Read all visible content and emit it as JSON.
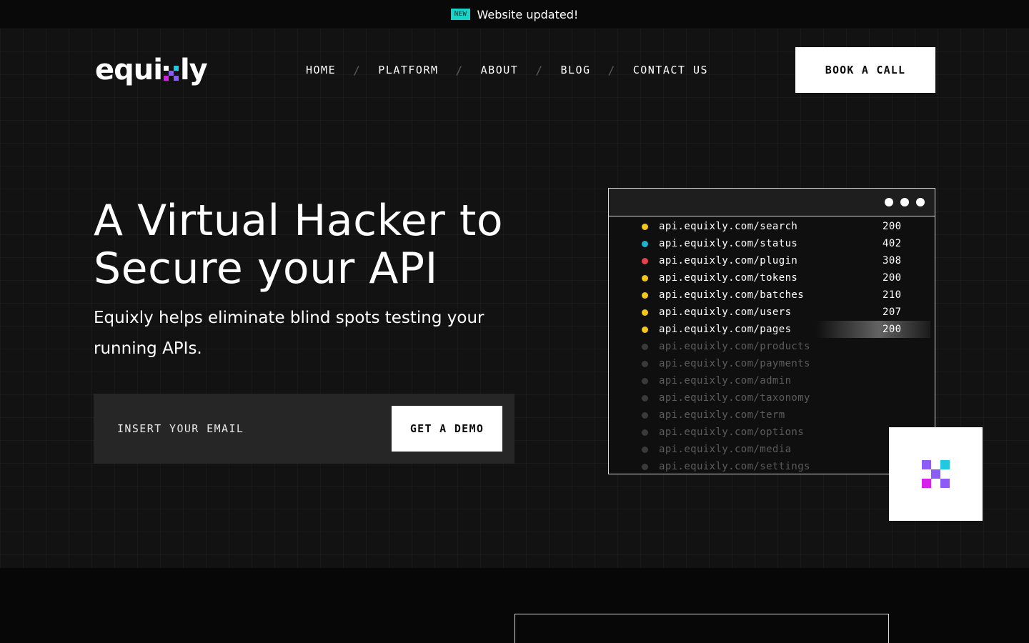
{
  "announcement": {
    "badge": "NEW",
    "message": "Website updated!"
  },
  "header": {
    "logo_text_left": "equi",
    "logo_text_right": "ly",
    "nav": [
      {
        "label": "HOME"
      },
      {
        "label": "PLATFORM"
      },
      {
        "label": "ABOUT"
      },
      {
        "label": "BLOG"
      },
      {
        "label": "CONTACT US"
      }
    ],
    "nav_separator": "/",
    "cta_label": "BOOK A CALL"
  },
  "hero": {
    "headline_line1": "A Virtual Hacker to",
    "headline_line2": "Secure your API",
    "subline": "Equixly helps eliminate blind spots testing your running APIs.",
    "email_placeholder": "INSERT YOUR EMAIL",
    "demo_button": "GET A DEMO"
  },
  "terminal": {
    "rows": [
      {
        "url": "api.equixly.com/search",
        "code": "200",
        "status_color": "#f5c518",
        "state": "active"
      },
      {
        "url": "api.equixly.com/status",
        "code": "402",
        "status_color": "#1fb3c9",
        "state": "active"
      },
      {
        "url": "api.equixly.com/plugin",
        "code": "308",
        "status_color": "#e8414b",
        "state": "active"
      },
      {
        "url": "api.equixly.com/tokens",
        "code": "200",
        "status_color": "#f5c518",
        "state": "active"
      },
      {
        "url": "api.equixly.com/batches",
        "code": "210",
        "status_color": "#f5c518",
        "state": "active"
      },
      {
        "url": "api.equixly.com/users",
        "code": "207",
        "status_color": "#f5c518",
        "state": "active"
      },
      {
        "url": "api.equixly.com/pages",
        "code": "200",
        "status_color": "#f5c518",
        "state": "scanning"
      },
      {
        "url": "api.equixly.com/products",
        "code": "",
        "status_color": "#3a3a3a",
        "state": "pending"
      },
      {
        "url": "api.equixly.com/payments",
        "code": "",
        "status_color": "#3a3a3a",
        "state": "pending"
      },
      {
        "url": "api.equixly.com/admin",
        "code": "",
        "status_color": "#3a3a3a",
        "state": "pending"
      },
      {
        "url": "api.equixly.com/taxonomy",
        "code": "",
        "status_color": "#3a3a3a",
        "state": "pending"
      },
      {
        "url": "api.equixly.com/term",
        "code": "",
        "status_color": "#3a3a3a",
        "state": "pending"
      },
      {
        "url": "api.equixly.com/options",
        "code": "",
        "status_color": "#3a3a3a",
        "state": "pending"
      },
      {
        "url": "api.equixly.com/media",
        "code": "",
        "status_color": "#3a3a3a",
        "state": "pending"
      },
      {
        "url": "api.equixly.com/settings",
        "code": "",
        "status_color": "#3a3a3a",
        "state": "pending"
      }
    ]
  },
  "colors": {
    "brand_cyan": "#22c7e0",
    "brand_purple": "#8b5cf6",
    "brand_magenta": "#d61fe8",
    "badge_teal": "#18d3c8"
  }
}
